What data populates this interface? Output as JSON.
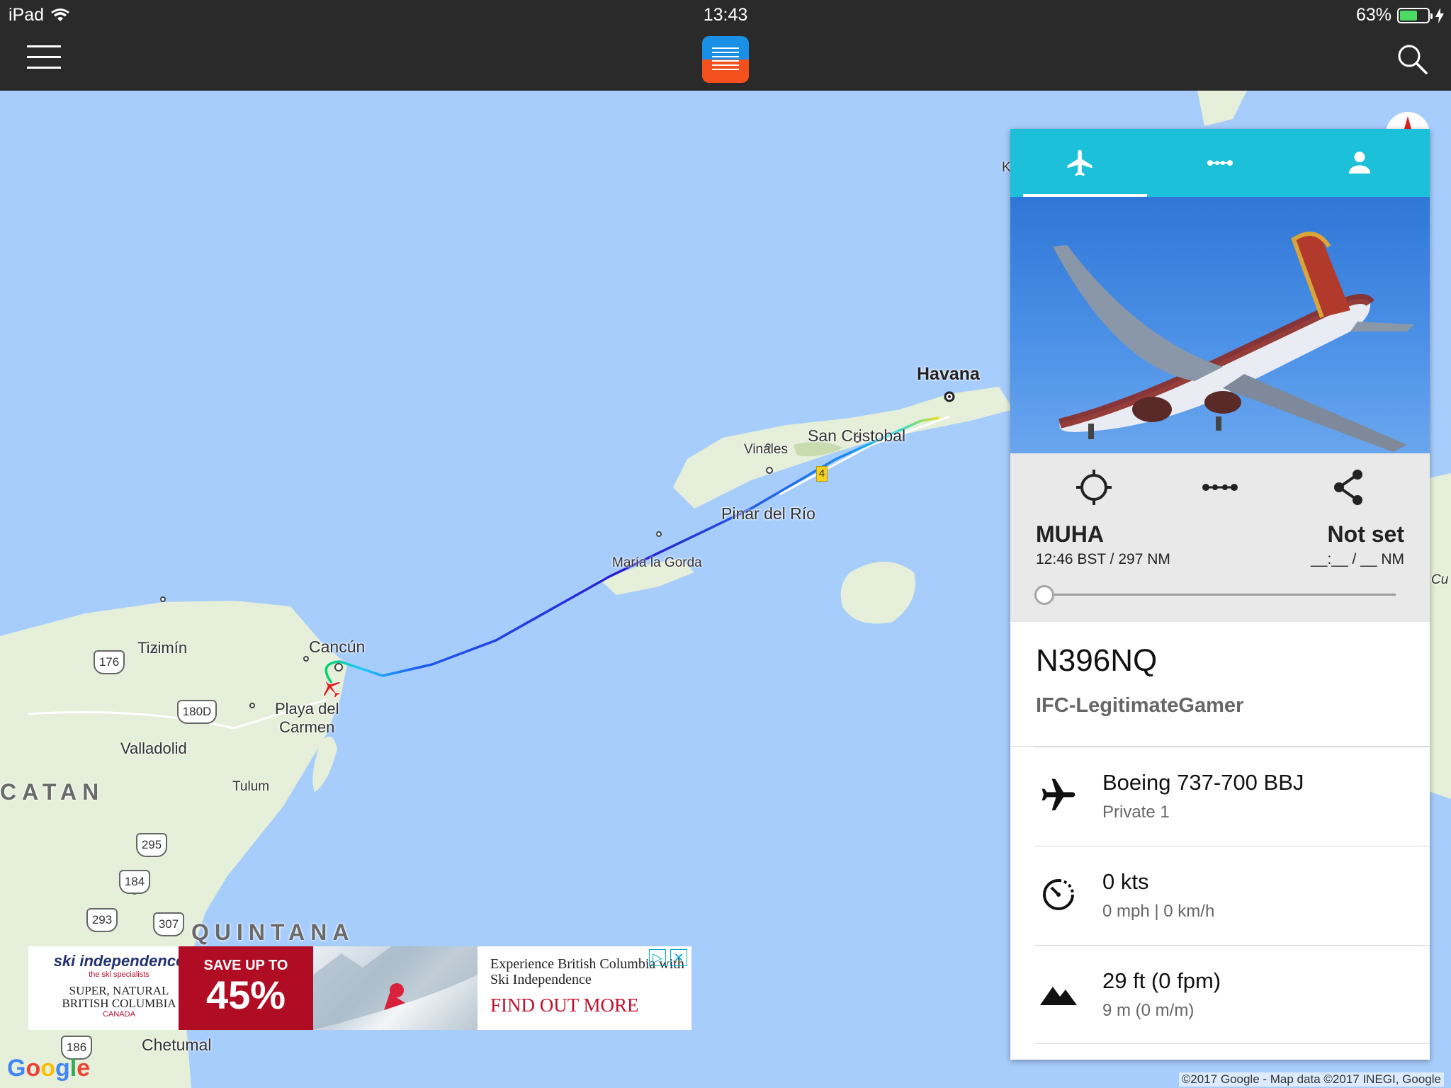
{
  "status_bar": {
    "device": "iPad",
    "time": "13:43",
    "battery": "63%",
    "battery_level": 0.63
  },
  "map": {
    "labels": {
      "havana": "Havana",
      "san_cristobal": "San Cristobal",
      "vinales": "Vinales",
      "pinar_del_rio": "Pinar del Río",
      "maria_la_gorda": "María la Gorda",
      "cancun": "Cancún",
      "tizimin": "Tizimín",
      "playa_del_carmen": "Playa del\nCarmen",
      "valladolid": "Valladolid",
      "tulum": "Tulum",
      "chetumal": "Chetumal",
      "yucatan": "CATAN",
      "quintana": "QUINTANA",
      "edge_k": "K",
      "edge_cu": "Cu",
      "route_marker": "4"
    },
    "shields": [
      "176",
      "180D",
      "295",
      "184",
      "293",
      "307",
      "186"
    ],
    "google": "Google",
    "copyright": "©2017 Google - Map data ©2017 INEGI, Google"
  },
  "ad": {
    "brand": "ski independence",
    "brand_tag": "the ski specialists",
    "brand_sub": "SUPER, NATURAL\nBRITISH COLUMBIA",
    "brand_country": "CANADA",
    "sale_line1": "SAVE UP TO",
    "sale_line2": "45%",
    "copy": "Experience British Columbia with Ski Independence",
    "cta": "FIND OUT MORE",
    "close": "✕"
  },
  "panel": {
    "tabs": [
      {
        "icon": "airplane-icon",
        "active": true
      },
      {
        "icon": "route-icon",
        "active": false
      },
      {
        "icon": "user-icon",
        "active": false
      }
    ],
    "origin": {
      "code": "MUHA",
      "info": "12:46 BST / 297 NM"
    },
    "destination": {
      "code": "Not set",
      "info": "__:__ / __ NM"
    },
    "progress": 0,
    "callsign": "N396NQ",
    "username": "IFC-LegitimateGamer",
    "aircraft": {
      "type": "Boeing 737-700 BBJ",
      "livery": "Private 1"
    },
    "speed": {
      "main": "0 kts",
      "sub": "0 mph | 0 km/h"
    },
    "altitude": {
      "main": "29 ft (0 fpm)",
      "sub": "9 m (0 m/m)"
    }
  },
  "colors": {
    "tab_bar": "#1cc0d8",
    "water": "#a7cdfc",
    "land": "#e6efd9",
    "top_bar": "#2a2a2a"
  }
}
